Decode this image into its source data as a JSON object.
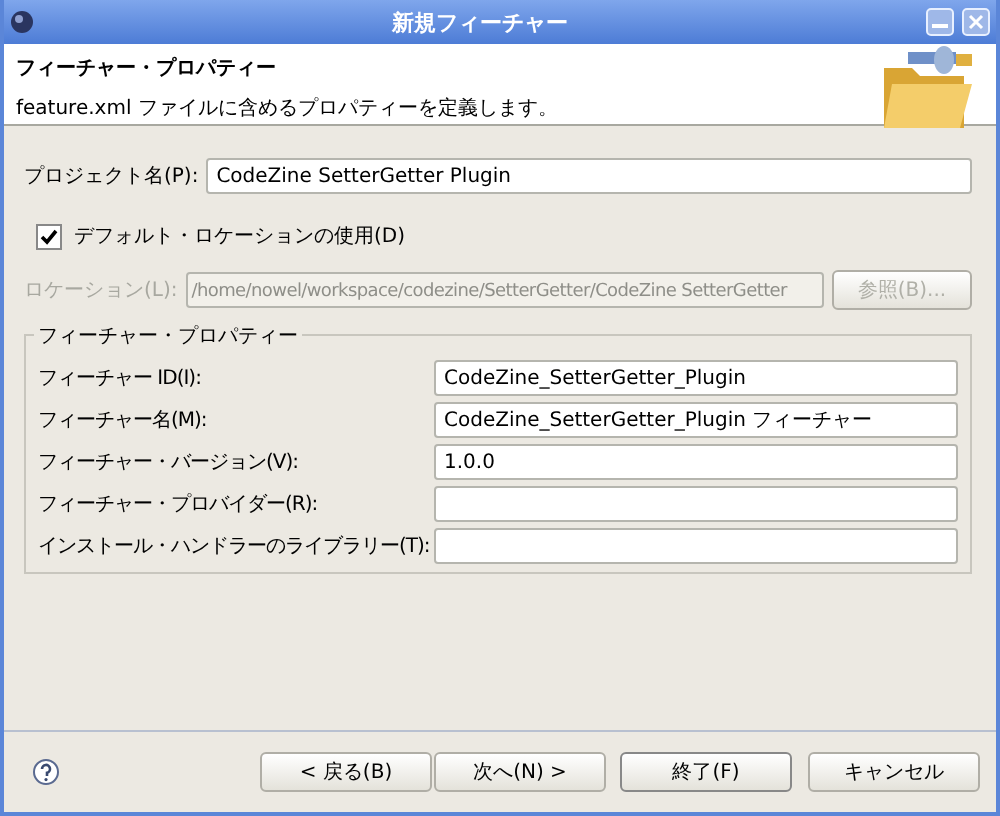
{
  "window": {
    "title": "新規フィーチャー"
  },
  "header": {
    "title": "フィーチャー・プロパティー",
    "description": "feature.xml ファイルに含めるプロパティーを定義します。"
  },
  "project_name": {
    "label": "プロジェクト名(P):",
    "value": "CodeZine SetterGetter Plugin"
  },
  "default_location": {
    "label": "デフォルト・ロケーションの使用(D)",
    "checked": true
  },
  "location": {
    "label": "ロケーション(L):",
    "value": "/home/nowel/workspace/codezine/SetterGetter/CodeZine SetterGetter",
    "button": "参照(B)...",
    "disabled": true
  },
  "feature_properties": {
    "title": "フィーチャー・プロパティー",
    "fields": [
      {
        "label": "フィーチャー ID(I):",
        "value": "CodeZine_SetterGetter_Plugin"
      },
      {
        "label": "フィーチャー名(M):",
        "value": "CodeZine_SetterGetter_Plugin フィーチャー"
      },
      {
        "label": "フィーチャー・バージョン(V):",
        "value": "1.0.0"
      },
      {
        "label": "フィーチャー・プロバイダー(R):"
      },
      {
        "label": "インストール・ハンドラーのライブラリー(T):"
      }
    ]
  },
  "buttons": [
    {
      "label": "< 戻る(B)",
      "default": false
    },
    {
      "label": "次へ(N) >",
      "default": false
    },
    {
      "label": "終了(F)",
      "default": true
    },
    {
      "label": "キャンセル",
      "default": false
    }
  ]
}
